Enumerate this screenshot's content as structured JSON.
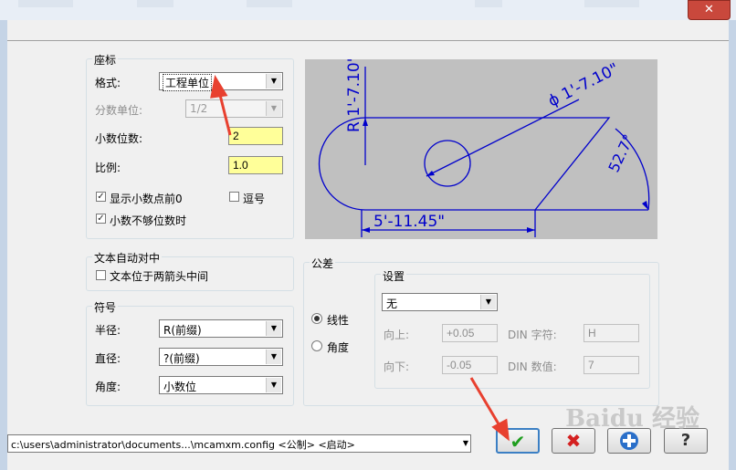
{
  "coords_group": {
    "title": "座标",
    "format_label": "格式:",
    "format_value": "工程单位",
    "fraction_unit_label": "分数单位:",
    "fraction_unit_value": "1/2",
    "decimals_label": "小数位数:",
    "decimals_value": "2",
    "scale_label": "比例:",
    "scale_value": "1.0",
    "show_leading_label": "显示小数点前0",
    "show_leading_checked": true,
    "comma_label": "逗号",
    "comma_checked": false,
    "trailing_label": "小数不够位数时",
    "trailing_checked": true
  },
  "text_center_group": {
    "title": "文本自动对中",
    "between_arrows_label": "文本位于两箭头中间",
    "between_arrows_checked": false
  },
  "symbol_group": {
    "title": "符号",
    "radius_label": "半径:",
    "radius_value": "R(前缀)",
    "diameter_label": "直径:",
    "diameter_value": "?(前缀)",
    "angle_label": "角度:",
    "angle_value": "小数位"
  },
  "tolerance_group": {
    "title": "公差",
    "linear_label": "线性",
    "linear_selected": true,
    "angular_label": "角度",
    "angular_selected": false,
    "settings": {
      "title": "设置",
      "mode_value": "无",
      "upper_label": "向上:",
      "upper_value": "+0.05",
      "lower_label": "向下:",
      "lower_value": "-0.05",
      "din_char_label": "DIN 字符:",
      "din_char_value": "H",
      "din_num_label": "DIN 数值:",
      "din_num_value": "7"
    }
  },
  "preview": {
    "radius_text": "R 1'-7.10\"",
    "diameter_text": "ϕ 1'-7.10\"",
    "angle_text": "52.7°",
    "length_text": "5'-11.45\""
  },
  "footer": {
    "config_path": "c:\\users\\administrator\\documents...\\mcamxm.config <公制> <启动>"
  },
  "buttons": {
    "ok_icon": "checkmark-icon",
    "cancel_icon": "red-x-icon",
    "help_plus_icon": "plus-icon",
    "help_icon": "question-icon"
  },
  "watermark_text": "Baidu 经验",
  "colors": {
    "preview_bg": "#c0c0c0",
    "preview_lines": "#0000cc",
    "highlight_input": "#ffff99",
    "arrow_red": "#e8402f"
  }
}
